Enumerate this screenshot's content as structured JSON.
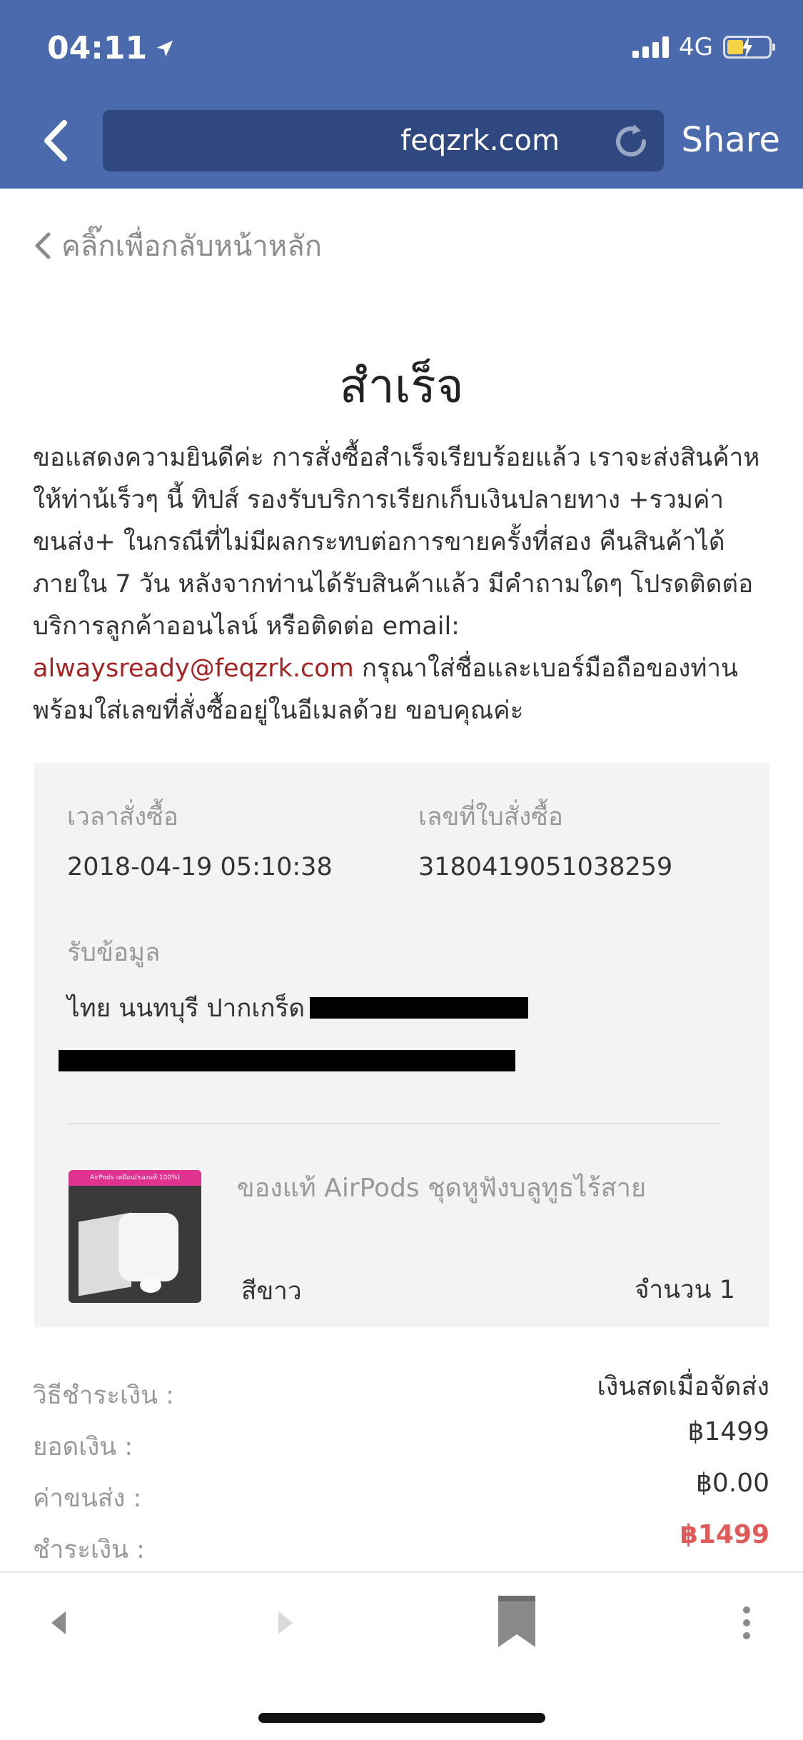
{
  "status_bar": {
    "time": "04:11",
    "network": "4G"
  },
  "browser": {
    "url": "feqzrk.com",
    "share_label": "Share"
  },
  "breadcrumb": {
    "label": "คลิ๊กเพื่อกลับหน้าหลัก"
  },
  "main": {
    "title": "สำเร็จ",
    "intro_before_email": "ขอแสดงความยินดีค่ะ การสั่งซื้อสำเร็จเรียบร้อยแล้ว เราจะส่งสินค้าหให้ท่าน้เร็วๆ นี้ ทิปส์ รองรับบริการเรียกเก็บเงินปลายทาง +รวมค่าขนส่ง+ ในกรณีที่ไม่มีผลกระทบต่อการขายครั้งที่สอง คืนสินค้าได้ภายใน 7 วัน หลังจากท่านได้รับสินค้าแล้ว มีคำถามใดๆ โปรดติดต่อบริการลูกค้าออนไลน์ หรือติดต่อ email: ",
    "email": "alwaysready@feqzrk.com",
    "intro_after_email": " กรุณาใส่ชื่อและเบอร์มือถือของท่าน พร้อมใส่เลขที่สั่งซื้ออยู่ในอีเมลด้วย ขอบคุณค่ะ"
  },
  "order": {
    "time_label": "เวลาสั่งซื้อ",
    "time_value": "2018-04-19 05:10:38",
    "number_label": "เลขที่ใบสั่งซื้อ",
    "number_value": "3180419051038259",
    "address_label": "รับข้อมูล",
    "address_value": "ไทย นนทบุรี ปากเกร็ด"
  },
  "product": {
    "image_tag": "AirPods เหมือน(ของแท้ 100%)",
    "name": "ของแท้ AirPods ชุดหูฟังบลูทูธไร้สาย",
    "color": "สีขาว",
    "quantity": "จำนวน 1"
  },
  "summary": {
    "payment_method_label": "วิธีชำระเงิน :",
    "payment_method_value": "เงินสดเมื่อจัดส่ง",
    "amount_label": "ยอดเงิน :",
    "amount_value": "฿1499",
    "shipping_label": "ค่าขนส่ง :",
    "shipping_value": "฿0.00",
    "total_label": "ชำระเงิน :",
    "total_value": "฿1499"
  },
  "colors": {
    "header": "#4b6aae",
    "url_box": "#2f4880",
    "email_link": "#a62323",
    "total": "#e05a5a",
    "panel": "#f3f3f3"
  },
  "icons": [
    "location-arrow-icon",
    "signal-icon",
    "battery-icon",
    "back-chevron-icon",
    "reload-icon",
    "nav-back-icon",
    "nav-forward-icon",
    "bookmark-icon",
    "more-icon"
  ]
}
